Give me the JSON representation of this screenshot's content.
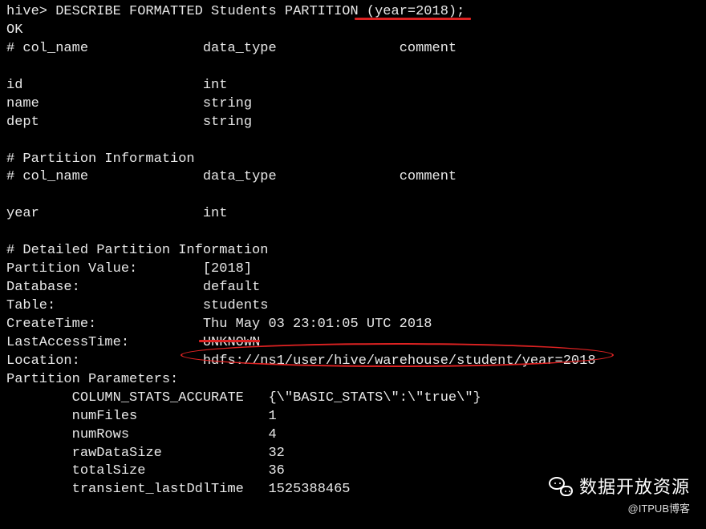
{
  "prompt": "hive> ",
  "command": "DESCRIBE FORMATTED Students PARTITION (year=2018);",
  "ok": "OK",
  "header": {
    "c1": "# col_name",
    "c2": "data_type",
    "c3": "comment"
  },
  "columns": [
    {
      "name": "id",
      "type": "int"
    },
    {
      "name": "name",
      "type": "string"
    },
    {
      "name": "dept",
      "type": "string"
    }
  ],
  "partition_info_header": "# Partition Information",
  "partition_header": {
    "c1": "# col_name",
    "c2": "data_type",
    "c3": "comment"
  },
  "partition_columns": [
    {
      "name": "year",
      "type": "int"
    }
  ],
  "detailed_header": "# Detailed Partition Information",
  "details": {
    "partition_value_label": "Partition Value:",
    "partition_value": "[2018]",
    "database_label": "Database:",
    "database": "default",
    "table_label": "Table:",
    "table": "students",
    "createtime_label": "CreateTime:",
    "createtime": "Thu May 03 23:01:05 UTC 2018",
    "lastaccess_label": "LastAccessTime:",
    "lastaccess": "UNKNOWN",
    "location_label": "Location:",
    "location": "hdfs://ns1/user/hive/warehouse/student/year=2018",
    "params_label": "Partition Parameters:"
  },
  "params": [
    {
      "key": "COLUMN_STATS_ACCURATE",
      "val": "{\\\"BASIC_STATS\\\":\\\"true\\\"}"
    },
    {
      "key": "numFiles",
      "val": "1"
    },
    {
      "key": "numRows",
      "val": "4"
    },
    {
      "key": "rawDataSize",
      "val": "32"
    },
    {
      "key": "totalSize",
      "val": "36"
    },
    {
      "key": "transient_lastDdlTime",
      "val": "1525388465"
    }
  ],
  "watermark": {
    "main": "数据开放资源",
    "sub": "@ITPUB博客"
  }
}
